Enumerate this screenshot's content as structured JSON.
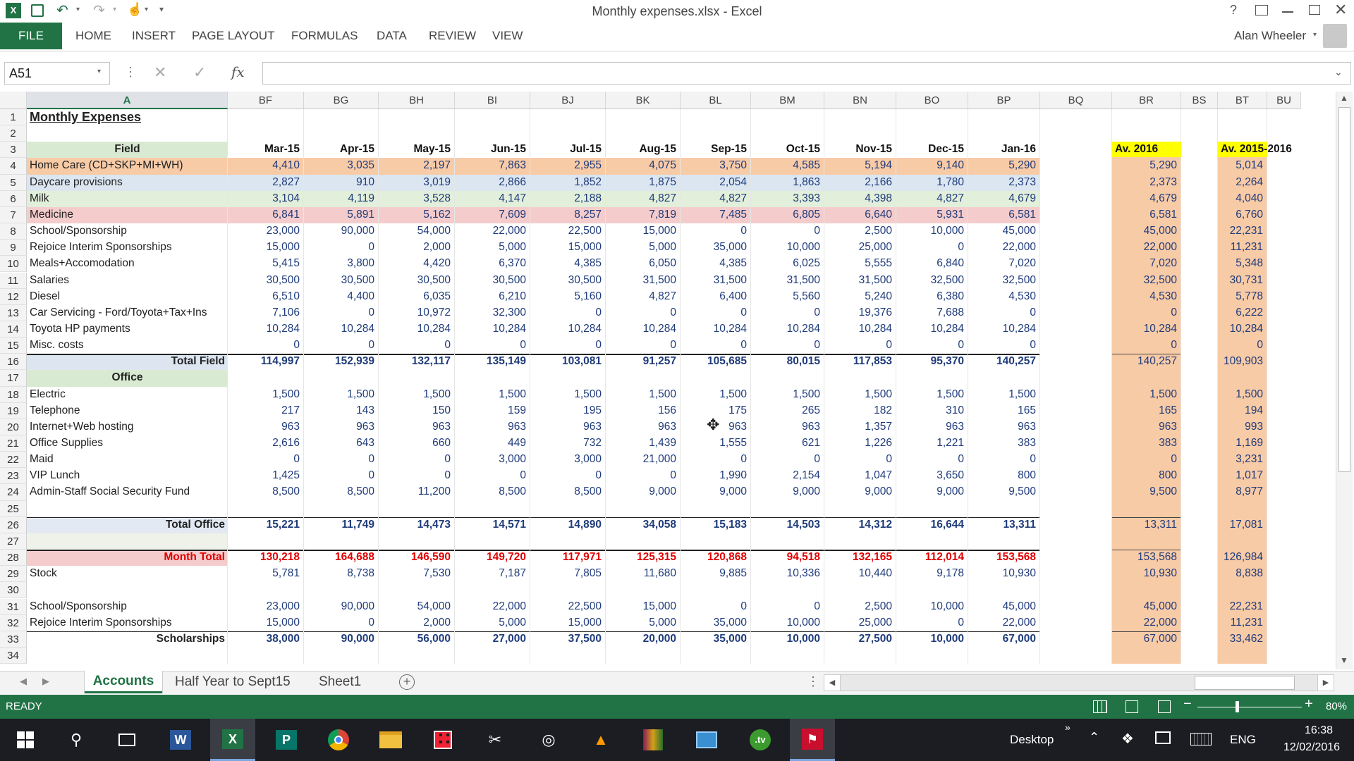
{
  "window": {
    "title": "Monthly expenses.xlsx - Excel",
    "user": "Alan Wheeler"
  },
  "ribbon_tabs": [
    "FILE",
    "HOME",
    "INSERT",
    "PAGE LAYOUT",
    "FORMULAS",
    "DATA",
    "REVIEW",
    "VIEW"
  ],
  "formula_bar": {
    "name_box": "A51",
    "fx": "fx",
    "value": ""
  },
  "columns": {
    "A": "A",
    "letters": [
      "BF",
      "BG",
      "BH",
      "BI",
      "BJ",
      "BK",
      "BL",
      "BM",
      "BN",
      "BO",
      "BP",
      "BQ",
      "BR",
      "BS",
      "BT",
      "BU"
    ]
  },
  "rows": [
    {
      "n": "1",
      "label": "Monthly Expenses",
      "vals": [],
      "br": "",
      "bt": ""
    },
    {
      "n": "2",
      "label": "",
      "vals": [],
      "br": "",
      "bt": ""
    },
    {
      "n": "3",
      "label": "Field",
      "vals": [
        "Mar-15",
        "Apr-15",
        "May-15",
        "Jun-15",
        "Jul-15",
        "Aug-15",
        "Sep-15",
        "Oct-15",
        "Nov-15",
        "Dec-15",
        "Jan-16"
      ],
      "br": "Av. 2016",
      "bt": "Av. 2015-2016"
    },
    {
      "n": "4",
      "label": "Home Care (CD+SKP+MI+WH)",
      "vals": [
        "4,410",
        "3,035",
        "2,197",
        "7,863",
        "2,955",
        "4,075",
        "3,750",
        "4,585",
        "5,194",
        "9,140",
        "5,290"
      ],
      "br": "5,290",
      "bt": "5,014"
    },
    {
      "n": "5",
      "label": "Daycare provisions",
      "vals": [
        "2,827",
        "910",
        "3,019",
        "2,866",
        "1,852",
        "1,875",
        "2,054",
        "1,863",
        "2,166",
        "1,780",
        "2,373"
      ],
      "br": "2,373",
      "bt": "2,264"
    },
    {
      "n": "6",
      "label": "Milk",
      "vals": [
        "3,104",
        "4,119",
        "3,528",
        "4,147",
        "2,188",
        "4,827",
        "4,827",
        "3,393",
        "4,398",
        "4,827",
        "4,679"
      ],
      "br": "4,679",
      "bt": "4,040"
    },
    {
      "n": "7",
      "label": "Medicine",
      "vals": [
        "6,841",
        "5,891",
        "5,162",
        "7,609",
        "8,257",
        "7,819",
        "7,485",
        "6,805",
        "6,640",
        "5,931",
        "6,581"
      ],
      "br": "6,581",
      "bt": "6,760"
    },
    {
      "n": "8",
      "label": "School/Sponsorship",
      "vals": [
        "23,000",
        "90,000",
        "54,000",
        "22,000",
        "22,500",
        "15,000",
        "0",
        "0",
        "2,500",
        "10,000",
        "45,000"
      ],
      "br": "45,000",
      "bt": "22,231"
    },
    {
      "n": "9",
      "label": "Rejoice Interim Sponsorships",
      "vals": [
        "15,000",
        "0",
        "2,000",
        "5,000",
        "15,000",
        "5,000",
        "35,000",
        "10,000",
        "25,000",
        "0",
        "22,000"
      ],
      "br": "22,000",
      "bt": "11,231"
    },
    {
      "n": "10",
      "label": "Meals+Accomodation",
      "vals": [
        "5,415",
        "3,800",
        "4,420",
        "6,370",
        "4,385",
        "6,050",
        "4,385",
        "6,025",
        "5,555",
        "6,840",
        "7,020"
      ],
      "br": "7,020",
      "bt": "5,348"
    },
    {
      "n": "11",
      "label": "Salaries",
      "vals": [
        "30,500",
        "30,500",
        "30,500",
        "30,500",
        "30,500",
        "31,500",
        "31,500",
        "31,500",
        "31,500",
        "32,500",
        "32,500"
      ],
      "br": "32,500",
      "bt": "30,731"
    },
    {
      "n": "12",
      "label": "Diesel",
      "vals": [
        "6,510",
        "4,400",
        "6,035",
        "6,210",
        "5,160",
        "4,827",
        "6,400",
        "5,560",
        "5,240",
        "6,380",
        "4,530"
      ],
      "br": "4,530",
      "bt": "5,778"
    },
    {
      "n": "13",
      "label": "Car Servicing - Ford/Toyota+Tax+Ins",
      "vals": [
        "7,106",
        "0",
        "10,972",
        "32,300",
        "0",
        "0",
        "0",
        "0",
        "19,376",
        "7,688",
        "0"
      ],
      "br": "0",
      "bt": "6,222"
    },
    {
      "n": "14",
      "label": "Toyota HP payments",
      "vals": [
        "10,284",
        "10,284",
        "10,284",
        "10,284",
        "10,284",
        "10,284",
        "10,284",
        "10,284",
        "10,284",
        "10,284",
        "10,284"
      ],
      "br": "10,284",
      "bt": "10,284"
    },
    {
      "n": "15",
      "label": "Misc. costs",
      "vals": [
        "0",
        "0",
        "0",
        "0",
        "0",
        "0",
        "0",
        "0",
        "0",
        "0",
        "0"
      ],
      "br": "0",
      "bt": "0"
    },
    {
      "n": "16",
      "label": "Total Field",
      "vals": [
        "114,997",
        "152,939",
        "132,117",
        "135,149",
        "103,081",
        "91,257",
        "105,685",
        "80,015",
        "117,853",
        "95,370",
        "140,257"
      ],
      "br": "140,257",
      "bt": "109,903"
    },
    {
      "n": "17",
      "label": "Office",
      "vals": [],
      "br": "",
      "bt": ""
    },
    {
      "n": "18",
      "label": "Electric",
      "vals": [
        "1,500",
        "1,500",
        "1,500",
        "1,500",
        "1,500",
        "1,500",
        "1,500",
        "1,500",
        "1,500",
        "1,500",
        "1,500"
      ],
      "br": "1,500",
      "bt": "1,500"
    },
    {
      "n": "19",
      "label": "Telephone",
      "vals": [
        "217",
        "143",
        "150",
        "159",
        "195",
        "156",
        "175",
        "265",
        "182",
        "310",
        "165"
      ],
      "br": "165",
      "bt": "194"
    },
    {
      "n": "20",
      "label": "Internet+Web hosting",
      "vals": [
        "963",
        "963",
        "963",
        "963",
        "963",
        "963",
        "963",
        "963",
        "1,357",
        "963",
        "963"
      ],
      "br": "963",
      "bt": "993"
    },
    {
      "n": "21",
      "label": "Office Supplies",
      "vals": [
        "2,616",
        "643",
        "660",
        "449",
        "732",
        "1,439",
        "1,555",
        "621",
        "1,226",
        "1,221",
        "383"
      ],
      "br": "383",
      "bt": "1,169"
    },
    {
      "n": "22",
      "label": "Maid",
      "vals": [
        "0",
        "0",
        "0",
        "3,000",
        "3,000",
        "21,000",
        "0",
        "0",
        "0",
        "0",
        "0"
      ],
      "br": "0",
      "bt": "3,231"
    },
    {
      "n": "23",
      "label": "VIP Lunch",
      "vals": [
        "1,425",
        "0",
        "0",
        "0",
        "0",
        "0",
        "1,990",
        "2,154",
        "1,047",
        "3,650",
        "800"
      ],
      "br": "800",
      "bt": "1,017"
    },
    {
      "n": "24",
      "label": "Admin-Staff Social Security Fund",
      "vals": [
        "8,500",
        "8,500",
        "11,200",
        "8,500",
        "8,500",
        "9,000",
        "9,000",
        "9,000",
        "9,000",
        "9,000",
        "9,500"
      ],
      "br": "9,500",
      "bt": "8,977"
    },
    {
      "n": "25",
      "label": "",
      "vals": [],
      "br": "",
      "bt": ""
    },
    {
      "n": "26",
      "label": "Total Office",
      "vals": [
        "15,221",
        "11,749",
        "14,473",
        "14,571",
        "14,890",
        "34,058",
        "15,183",
        "14,503",
        "14,312",
        "16,644",
        "13,311"
      ],
      "br": "13,311",
      "bt": "17,081"
    },
    {
      "n": "27",
      "label": "",
      "vals": [],
      "br": "",
      "bt": ""
    },
    {
      "n": "28",
      "label": "Month Total",
      "vals": [
        "130,218",
        "164,688",
        "146,590",
        "149,720",
        "117,971",
        "125,315",
        "120,868",
        "94,518",
        "132,165",
        "112,014",
        "153,568"
      ],
      "br": "153,568",
      "bt": "126,984"
    },
    {
      "n": "29",
      "label": "Stock",
      "vals": [
        "5,781",
        "8,738",
        "7,530",
        "7,187",
        "7,805",
        "11,680",
        "9,885",
        "10,336",
        "10,440",
        "9,178",
        "10,930"
      ],
      "br": "10,930",
      "bt": "8,838"
    },
    {
      "n": "30",
      "label": "",
      "vals": [],
      "br": "",
      "bt": ""
    },
    {
      "n": "31",
      "label": "School/Sponsorship",
      "vals": [
        "23,000",
        "90,000",
        "54,000",
        "22,000",
        "22,500",
        "15,000",
        "0",
        "0",
        "2,500",
        "10,000",
        "45,000"
      ],
      "br": "45,000",
      "bt": "22,231"
    },
    {
      "n": "32",
      "label": "Rejoice Interim Sponsorships",
      "vals": [
        "15,000",
        "0",
        "2,000",
        "5,000",
        "15,000",
        "5,000",
        "35,000",
        "10,000",
        "25,000",
        "0",
        "22,000"
      ],
      "br": "22,000",
      "bt": "11,231"
    },
    {
      "n": "33",
      "label": "Scholarships",
      "vals": [
        "38,000",
        "90,000",
        "56,000",
        "27,000",
        "37,500",
        "20,000",
        "35,000",
        "10,000",
        "27,500",
        "10,000",
        "67,000"
      ],
      "br": "67,000",
      "bt": "33,462"
    },
    {
      "n": "34",
      "label": "",
      "vals": [],
      "br": "",
      "bt": ""
    }
  ],
  "sheets": [
    "Accounts",
    "Half Year to Sept15",
    "Sheet1"
  ],
  "status": {
    "mode": "READY",
    "zoom": "80%"
  },
  "taskbar": {
    "desktop": "Desktop",
    "lang": "ENG",
    "time": "16:38",
    "date": "12/02/2016"
  },
  "colors": {
    "excel_green": "#217346",
    "yellow": "#ffff00",
    "peach": "#f8cba7",
    "field_green": "#d9ead3"
  }
}
